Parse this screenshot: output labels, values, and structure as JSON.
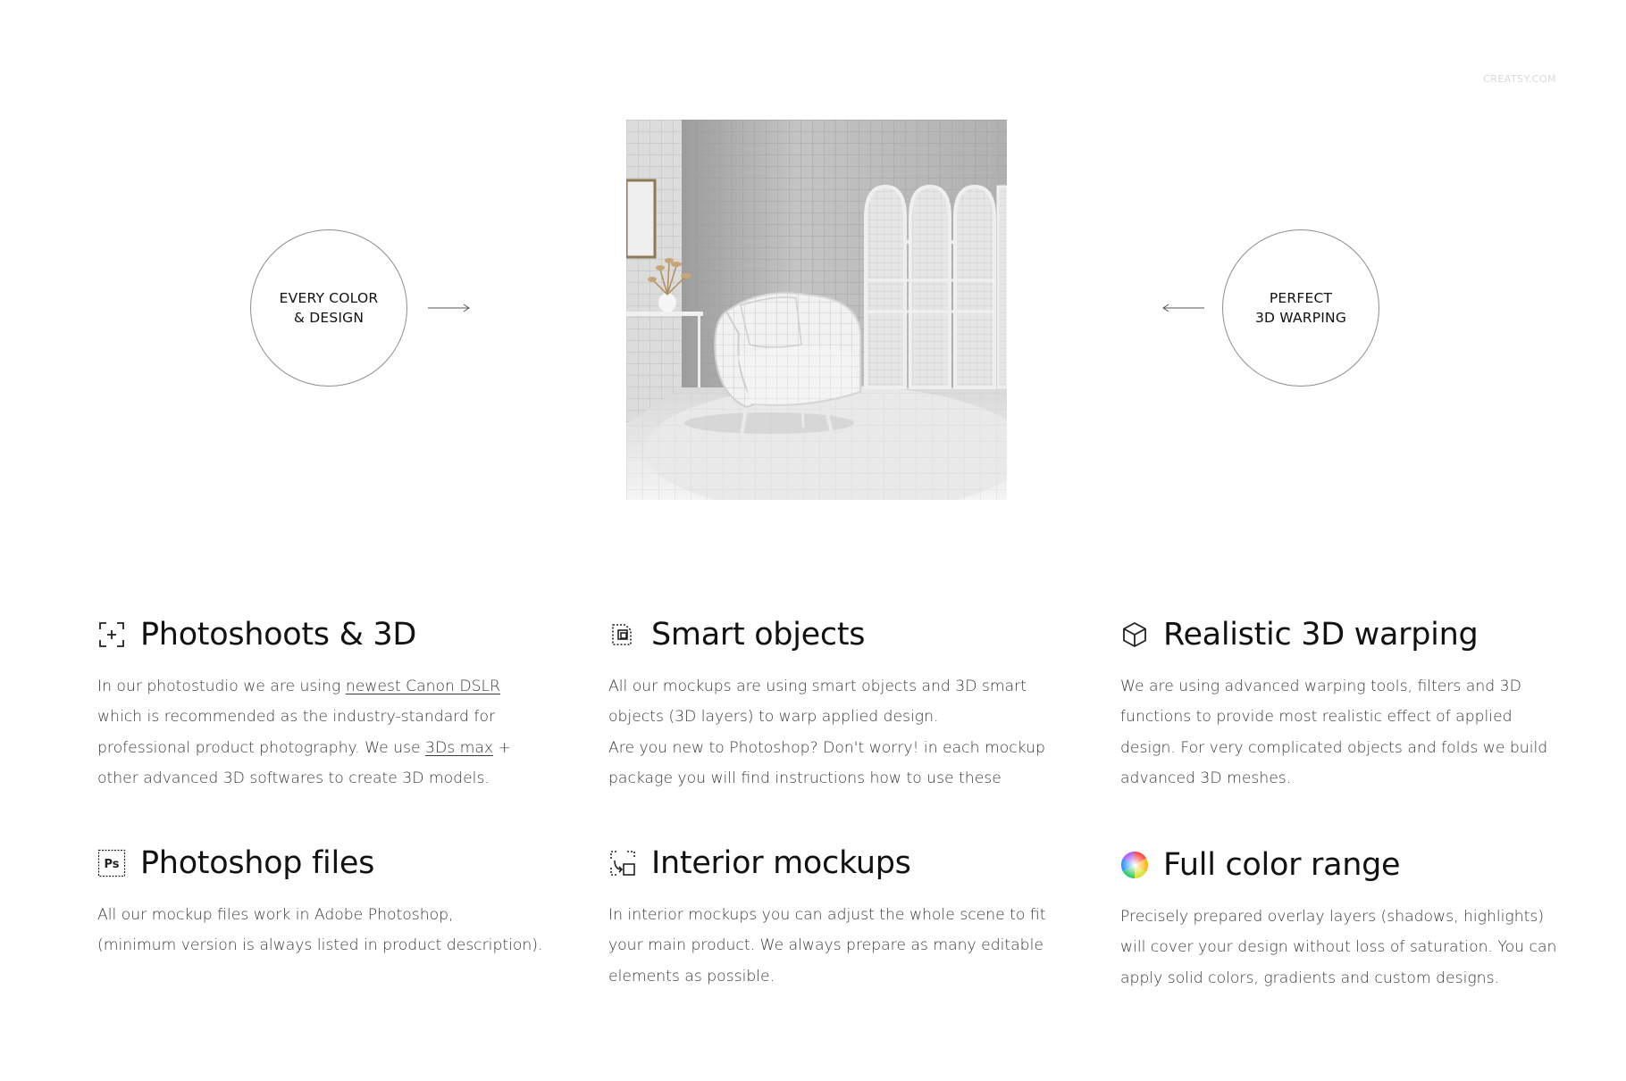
{
  "watermark": "CREATSY.COM",
  "badges": {
    "left": {
      "line1": "EVERY COLOR",
      "line2": "& DESIGN"
    },
    "right": {
      "line1": "PERFECT",
      "line2": "3D WARPING"
    }
  },
  "features": [
    {
      "icon": "photoshoot-icon",
      "title": "Photoshoots & 3D",
      "lines": [
        {
          "before": "In our photostudio we are using ",
          "link": "newest Canon DSLR",
          "after": ""
        },
        {
          "before": "which is recommended as the industry-standard for",
          "link": "",
          "after": ""
        },
        {
          "before": "professional product photography.  We use ",
          "link": "3Ds max",
          "after": " +"
        },
        {
          "before": "other advanced 3D softwares to create 3D models.",
          "link": "",
          "after": ""
        }
      ]
    },
    {
      "icon": "smart-object-icon",
      "title": "Smart objects",
      "lines": [
        {
          "before": "All our mockups are using smart objects and 3D smart",
          "link": "",
          "after": ""
        },
        {
          "before": "objects (3D layers) to warp applied design.",
          "link": "",
          "after": ""
        },
        {
          "before": "Are you new to Photoshop? Don't worry! in each mockup",
          "link": "",
          "after": ""
        },
        {
          "before": "package you will find instructions how to use these",
          "link": "",
          "after": ""
        }
      ]
    },
    {
      "icon": "cube-icon",
      "title": "Realistic 3D warping",
      "lines": [
        {
          "before": "We are using advanced warping tools, filters and 3D",
          "link": "",
          "after": ""
        },
        {
          "before": "functions to provide most realistic effect of applied",
          "link": "",
          "after": ""
        },
        {
          "before": "design. For very complicated objects and folds we build",
          "link": "",
          "after": ""
        },
        {
          "before": "advanced 3D meshes.",
          "link": "",
          "after": ""
        }
      ]
    },
    {
      "icon": "photoshop-icon",
      "title": "Photoshop files",
      "lines": [
        {
          "before": "All our mockup files work in Adobe Photoshop,",
          "link": "",
          "after": ""
        },
        {
          "before": "(minimum version is always listed in product description).",
          "link": "",
          "after": ""
        }
      ]
    },
    {
      "icon": "interior-icon",
      "title": "Interior mockups",
      "lines": [
        {
          "before": "In interior mockups you can adjust the whole scene to fit",
          "link": "",
          "after": ""
        },
        {
          "before": "your main product. We always prepare as many editable",
          "link": "",
          "after": ""
        },
        {
          "before": "elements as possible.",
          "link": "",
          "after": ""
        }
      ]
    },
    {
      "icon": "color-wheel-icon",
      "title": "Full color range",
      "lines": [
        {
          "before": "Precisely prepared overlay layers (shadows, highlights)",
          "link": "",
          "after": ""
        },
        {
          "before": "will cover your design without loss of saturation. You can",
          "link": "",
          "after": ""
        },
        {
          "before": "apply solid colors, gradients and custom designs.",
          "link": "",
          "after": ""
        }
      ]
    }
  ]
}
